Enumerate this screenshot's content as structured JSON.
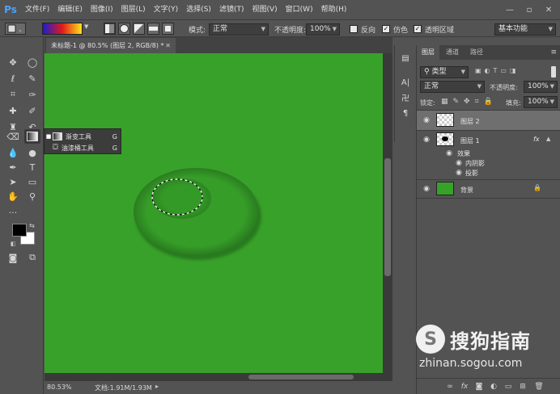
{
  "app": {
    "logo": "Ps"
  },
  "menu": [
    "文件(F)",
    "编辑(E)",
    "图像(I)",
    "图层(L)",
    "文字(Y)",
    "选择(S)",
    "滤镜(T)",
    "视图(V)",
    "窗口(W)",
    "帮助(H)"
  ],
  "window_controls": [
    "minimize-icon",
    "maximize-icon",
    "close-icon"
  ],
  "options": {
    "mode_label": "模式:",
    "mode_value": "正常",
    "opacity_label": "不透明度:",
    "opacity_value": "100%",
    "reverse_label": "反向",
    "dither_label": "仿色",
    "transparency_label": "透明区域",
    "workspace_value": "基本功能",
    "gradient_colors": [
      "#1b1bd0",
      "#e11a1a",
      "#ffe419"
    ]
  },
  "document": {
    "tab_title": "未标题-1 @ 80.5% (图层 2, RGB/8) *",
    "canvas_color": "#38a12a",
    "zoom": "80.53%",
    "doc_info": "文档:1.91M/1.93M"
  },
  "flyout": [
    {
      "label": "渐变工具",
      "shortcut": "G",
      "selected": true
    },
    {
      "label": "油漆桶工具",
      "shortcut": "G",
      "selected": false
    }
  ],
  "layers_panel": {
    "tabs": [
      "图层",
      "通道",
      "路径"
    ],
    "filter_label": "类型",
    "blend_mode": "正常",
    "opacity_label": "不透明度:",
    "opacity_value": "100%",
    "lock_label": "锁定:",
    "fill_label": "填充:",
    "fill_value": "100%",
    "layers": [
      {
        "name": "图层 2",
        "selected": true
      },
      {
        "name": "图层 1",
        "fx": "fx"
      },
      {
        "name": "效果"
      },
      {
        "name": "内阴影"
      },
      {
        "name": "投影"
      },
      {
        "name": "背景"
      }
    ]
  },
  "watermark": {
    "brand_letter": "S",
    "brand_text": "搜狗指南",
    "url": "zhinan.sogou.com"
  }
}
